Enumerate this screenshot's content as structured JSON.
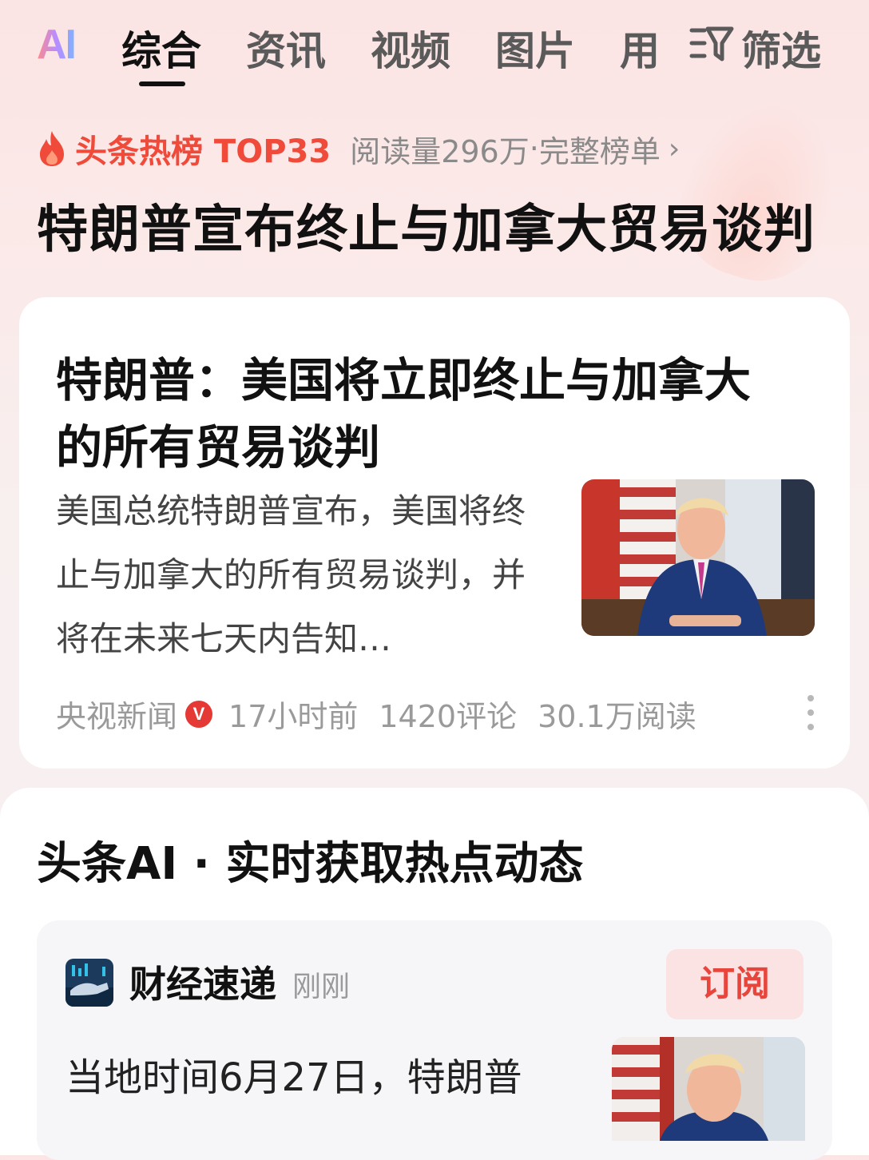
{
  "tabs": {
    "ai_logo": "AI",
    "items": [
      "综合",
      "资讯",
      "视频",
      "图片",
      "用"
    ],
    "active_index": 0,
    "filter_label": "筛选"
  },
  "hotlist": {
    "rank_label": "头条热榜 TOP33",
    "reads": "阅读量296万",
    "separator": " · ",
    "full_list": "完整榜单",
    "chevron": "›",
    "headline": "特朗普宣布终止与加拿大贸易谈判"
  },
  "article": {
    "title": "特朗普：美国将立即终止与加拿大的所有贸易谈判",
    "summary": "美国总统特朗普宣布，美国将终止与加拿大的所有贸易谈判，并将在未来七天内告知…",
    "source": "央视新闻",
    "verified_badge": "V",
    "time": "17小时前",
    "comments": "1420评论",
    "reads": "30.1万阅读"
  },
  "ai_section": {
    "title": "头条AI · 实时获取热点动态",
    "channel_name": "财经速递",
    "channel_time": "刚刚",
    "subscribe_label": "订阅",
    "text": "当地时间6月27日，特朗普"
  },
  "colors": {
    "accent_red": "#f04a3a",
    "subscribe_bg": "#fbe3e3",
    "verified_red": "#e53935"
  }
}
